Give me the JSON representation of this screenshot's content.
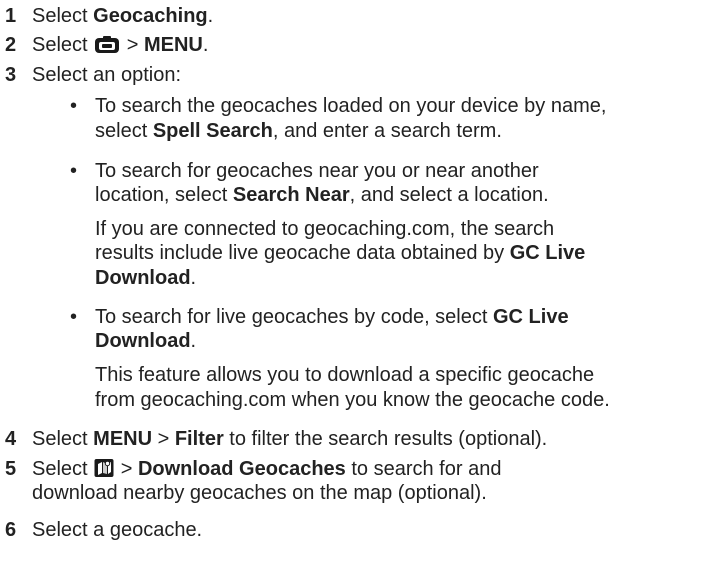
{
  "steps": [
    {
      "number": "1",
      "pre": "Select ",
      "bold": "Geocaching",
      "post": "."
    },
    {
      "number": "2",
      "pre": "Select ",
      "icon": "geocache-menu-icon",
      "mid": " > ",
      "bold": "MENU",
      "post": "."
    },
    {
      "number": "3",
      "text": "Select an option:"
    },
    {
      "number": "4",
      "pre": "Select ",
      "bold1": "MENU",
      "mid": " > ",
      "bold2": "Filter",
      "post": " to filter the search results (optional)."
    },
    {
      "number": "5",
      "pre": "Select ",
      "icon": "map-icon",
      "mid": " > ",
      "bold": "Download Geocaches",
      "post1": " to search for and",
      "line2": "download nearby geocaches on the map (optional)."
    },
    {
      "number": "6",
      "text": "Select a geocache."
    }
  ],
  "options": [
    {
      "line1": "To search the geocaches loaded on your device by name,",
      "pre2": "select ",
      "bold": "Spell Search",
      "post2": ", and enter a search term."
    },
    {
      "line1": "To search for geocaches near you or near another",
      "pre2": "location, select ",
      "bold": "Search Near",
      "post2": ", and select a location.",
      "note_line1": "If you are connected to geocaching.com, the search",
      "note_pre2": "results include live geocache data obtained by ",
      "note_bold2": "GC Live",
      "note_bold3": "Download",
      "note_post3": "."
    },
    {
      "pre1": "To search for live geocaches by code, select ",
      "bold1": "GC Live",
      "bold2": "Download",
      "post2": ".",
      "note_line1": "This feature allows you to download a specific geocache",
      "note_line2": "from geocaching.com when you know the geocache code."
    }
  ],
  "bullet_char": "•",
  "colors": {
    "text": "#222222",
    "icon_fill": "#1a1a1a"
  }
}
